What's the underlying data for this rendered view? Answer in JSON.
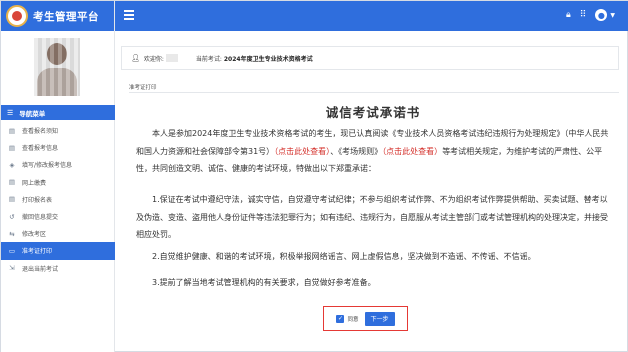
{
  "app": {
    "title": "考生管理平台"
  },
  "sidebar": {
    "menu_header": "导航菜单",
    "items": [
      {
        "label": "查看报名须知",
        "icon": "doc-icon"
      },
      {
        "label": "查看报考信息",
        "icon": "doc-icon"
      },
      {
        "label": "填写/修改报考信息",
        "icon": "shield-icon"
      },
      {
        "label": "网上缴费",
        "icon": "doc-icon"
      },
      {
        "label": "打印报名表",
        "icon": "doc-icon"
      },
      {
        "label": "撤回信息提交",
        "icon": "undo-icon"
      },
      {
        "label": "修改考区",
        "icon": "swap-icon"
      },
      {
        "label": "准考证打印",
        "icon": "card-icon",
        "active": true
      },
      {
        "label": "退出当前考试",
        "icon": "exit-icon"
      }
    ]
  },
  "infobar": {
    "welcome": "欢迎你:",
    "current_exam_label": "当前考试:",
    "current_exam": "2024年度卫生专业技术资格考试"
  },
  "breadcrumb": "准考证打印",
  "document": {
    "title": "诚信考试承诺书",
    "p1_a": "本人是参加2024年度卫生专业技术资格考试的考生，现已认真阅读《专业技术人员资格考试违纪违规行为处理规定》（中华人民共和国人力资源和社会保障部令第31号）",
    "p1_link1": "（点击此处查看）",
    "p1_b": "、《考场规则》",
    "p1_link2": "（点击此处查看）",
    "p1_c": "等考试相关规定，为维护考试的严肃性、公平性，共同创造文明、诚信、健康的考试环境，特做出以下郑重承诺：",
    "p2": "1.保证在考试中遵纪守法，诚实守信，自觉遵守考试纪律；不参与组织考试作弊、不为组织考试作弊提供帮助、买卖试题、替考以及伪造、变造、盗用他人身份证件等违法犯罪行为；如有违纪、违规行为，自愿服从考试主管部门或考试管理机构的处理决定，并接受相应处罚。",
    "p3": "2.自觉维护健康、和谐的考试环境，积极举报网络谣言、网上虚假信息，坚决做到不造谣、不传谣、不信谣。",
    "p4": "3.提前了解当地考试管理机构的有关要求，自觉做好参考准备。"
  },
  "actions": {
    "agree_label": "同意",
    "agree_checked": true,
    "next_label": "下一步"
  },
  "colors": {
    "primary": "#2f6edd",
    "link_red": "#d4302b",
    "highlight_border": "#e53935"
  }
}
